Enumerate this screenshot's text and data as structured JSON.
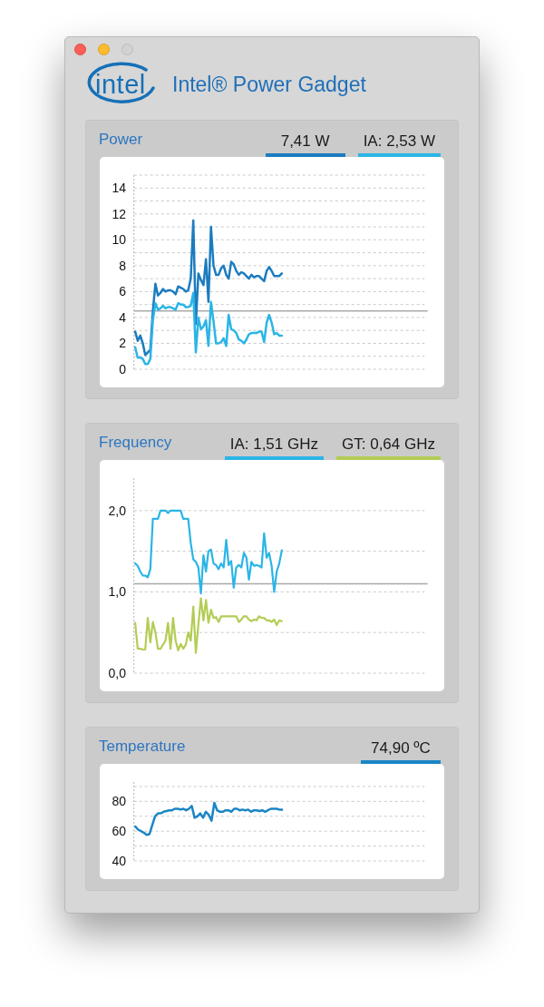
{
  "window": {
    "controls": [
      {
        "kind": "close",
        "disabled": false
      },
      {
        "kind": "minimize",
        "disabled": false
      },
      {
        "kind": "zoom",
        "disabled": true
      }
    ]
  },
  "header": {
    "logo": {
      "text": "intel"
    },
    "title": "Intel® Power Gadget"
  },
  "panels": [
    {
      "title": "Power",
      "readouts": [
        {
          "text": "7,41 W",
          "color": "#1b7cbf"
        },
        {
          "text": "IA: 2,53 W",
          "color": "#2bb5e6"
        }
      ],
      "chart_data": {
        "type": "line",
        "ylim": [
          0,
          15
        ],
        "yticks": [
          0,
          2,
          4,
          6,
          8,
          10,
          12,
          14
        ],
        "grid": true,
        "series": [
          {
            "color": "#1b7cbf",
            "values": [
              2.9,
              2.2,
              2.6,
              2.0,
              1.1,
              1.3,
              1.5,
              4.5,
              6.6,
              5.7,
              5.9,
              6.2,
              6.0,
              6.1,
              6.1,
              6.0,
              5.8,
              6.4,
              6.3,
              6.2,
              6.0,
              6.1,
              7.0,
              11.5,
              3.5,
              7.4,
              6.9,
              6.5,
              8.5,
              5.2,
              11.0,
              8.0,
              7.3,
              7.3,
              7.8,
              8.0,
              7.3,
              7.0,
              8.3,
              8.1,
              7.6,
              7.3,
              7.5,
              7.4,
              7.2,
              7.0,
              7.3,
              7.1,
              7.2,
              7.2,
              7.0,
              6.8,
              7.6,
              7.9,
              7.6,
              7.2,
              7.2,
              7.2,
              7.4,
              null,
              null,
              null,
              null,
              null,
              null,
              null,
              null,
              null,
              null,
              null,
              null,
              null,
              null,
              null,
              null,
              null,
              null,
              null,
              null,
              null,
              null,
              null,
              null,
              null,
              null,
              null,
              null,
              null,
              null,
              null,
              null,
              null,
              null,
              null,
              null,
              null,
              null,
              null,
              null,
              null,
              null,
              null,
              null,
              null,
              null,
              null,
              null,
              null,
              null,
              null,
              null,
              null,
              null,
              null,
              null
            ]
          },
          {
            "color": "#2bb5e6",
            "values": [
              1.7,
              0.9,
              0.9,
              0.8,
              0.4,
              0.4,
              0.8,
              3.8,
              5.1,
              4.6,
              4.7,
              4.9,
              4.7,
              4.8,
              4.8,
              4.7,
              4.6,
              5.1,
              5.0,
              5.0,
              4.8,
              4.8,
              4.9,
              5.9,
              1.3,
              4.0,
              3.1,
              3.3,
              3.8,
              1.8,
              5.2,
              3.7,
              2.0,
              2.0,
              2.1,
              2.4,
              1.8,
              4.2,
              3.1,
              3.0,
              2.8,
              2.3,
              2.2,
              2.0,
              2.3,
              2.7,
              2.8,
              2.8,
              2.8,
              2.9,
              2.9,
              2.1,
              3.6,
              4.2,
              3.6,
              2.7,
              2.8,
              2.6,
              2.6,
              null,
              null,
              null,
              null,
              null,
              null,
              null,
              null,
              null,
              null,
              null,
              null,
              null,
              null,
              null,
              null,
              null,
              null,
              null,
              null,
              null,
              null,
              null,
              null,
              null,
              null,
              null,
              null,
              null,
              null,
              null,
              null,
              null,
              null,
              null,
              null,
              null,
              null,
              null,
              null,
              null,
              null,
              null,
              null,
              null,
              null,
              null,
              null,
              null,
              null,
              null,
              null,
              null,
              null,
              null,
              null
            ]
          }
        ],
        "ref_lines": [
          {
            "axis": "y",
            "value": 4.5
          }
        ]
      }
    },
    {
      "title": "Frequency",
      "readouts": [
        {
          "text": "IA: 1,51 GHz",
          "color": "#2bb5e6"
        },
        {
          "text": "GT: 0,64 GHz",
          "color": "#b3cd55"
        }
      ],
      "chart_data": {
        "type": "line",
        "ylim": [
          0,
          2.4
        ],
        "yticks": [
          {
            "value": 0,
            "label": "0,0"
          },
          {
            "value": 1,
            "label": "1,0"
          },
          {
            "value": 2,
            "label": "2,0"
          }
        ],
        "grid": true,
        "series": [
          {
            "color": "#2bb5e6",
            "values": [
              1.35,
              1.32,
              1.25,
              1.2,
              1.2,
              1.18,
              1.28,
              1.9,
              1.9,
              1.9,
              2.0,
              2.0,
              2.0,
              1.97,
              2.0,
              2.0,
              2.0,
              2.0,
              2.0,
              1.9,
              1.9,
              1.9,
              1.6,
              1.4,
              1.37,
              1.3,
              0.98,
              1.45,
              1.25,
              1.5,
              1.52,
              1.35,
              1.33,
              1.28,
              1.35,
              1.3,
              1.64,
              1.33,
              1.38,
              1.05,
              1.3,
              1.33,
              1.3,
              1.48,
              1.42,
              1.15,
              1.37,
              1.32,
              1.33,
              1.32,
              1.3,
              1.72,
              1.42,
              1.48,
              1.32,
              1.0,
              1.25,
              1.35,
              1.51,
              null,
              null,
              null,
              null,
              null,
              null,
              null,
              null,
              null,
              null,
              null,
              null,
              null,
              null,
              null,
              null,
              null,
              null,
              null,
              null,
              null,
              null,
              null,
              null,
              null,
              null,
              null,
              null,
              null,
              null,
              null,
              null,
              null,
              null,
              null,
              null,
              null,
              null,
              null,
              null,
              null,
              null,
              null,
              null,
              null,
              null,
              null,
              null,
              null,
              null,
              null,
              null,
              null,
              null,
              null,
              null
            ]
          },
          {
            "color": "#b3cd55",
            "values": [
              0.62,
              0.3,
              0.3,
              0.29,
              0.29,
              0.68,
              0.38,
              0.63,
              0.5,
              0.3,
              0.3,
              0.35,
              0.4,
              0.62,
              0.3,
              0.68,
              0.4,
              0.28,
              0.36,
              0.3,
              0.35,
              0.5,
              0.4,
              0.82,
              0.25,
              0.6,
              0.92,
              0.65,
              0.9,
              0.62,
              0.78,
              0.68,
              0.69,
              0.63,
              0.7,
              0.7,
              0.7,
              0.7,
              0.7,
              0.7,
              0.7,
              0.63,
              0.66,
              0.7,
              0.7,
              0.66,
              0.64,
              0.66,
              0.65,
              0.7,
              0.68,
              0.68,
              0.65,
              0.65,
              0.63,
              0.66,
              0.59,
              0.65,
              0.64,
              null,
              null,
              null,
              null,
              null,
              null,
              null,
              null,
              null,
              null,
              null,
              null,
              null,
              null,
              null,
              null,
              null,
              null,
              null,
              null,
              null,
              null,
              null,
              null,
              null,
              null,
              null,
              null,
              null,
              null,
              null,
              null,
              null,
              null,
              null,
              null,
              null,
              null,
              null,
              null,
              null,
              null,
              null,
              null,
              null,
              null,
              null,
              null,
              null,
              null,
              null,
              null,
              null,
              null,
              null,
              null
            ]
          }
        ],
        "ref_lines": [
          {
            "axis": "y",
            "value": 1.1
          }
        ]
      }
    },
    {
      "title": "Temperature",
      "readouts": [
        {
          "text": "74,90 ºC",
          "color": "#1b85c6"
        }
      ],
      "chart_data": {
        "type": "line",
        "ylim": [
          40,
          93
        ],
        "yticks": [
          40,
          60,
          80
        ],
        "grid": true,
        "series": [
          {
            "color": "#1b85c6",
            "values": [
              63,
              61,
              60,
              59,
              57.5,
              58,
              64,
              70,
              72,
              72,
              73,
              73.5,
              74,
              74,
              75,
              75,
              74.5,
              75,
              74,
              75,
              77,
              69,
              70,
              72,
              69,
              73,
              71,
              67,
              79,
              74,
              73,
              73,
              74,
              74,
              73,
              75,
              75,
              74,
              74.5,
              74,
              74.5,
              73,
              74,
              74,
              73.5,
              74,
              73,
              74,
              75,
              75,
              75,
              74.5,
              74.5,
              null,
              null,
              null,
              null,
              null,
              null,
              null,
              null,
              null,
              null,
              null,
              null,
              null,
              null,
              null,
              null,
              null,
              null,
              null,
              null,
              null,
              null,
              null,
              null,
              null,
              null,
              null,
              null,
              null,
              null,
              null,
              null,
              null,
              null,
              null,
              null,
              null,
              null,
              null,
              null,
              null,
              null,
              null,
              null,
              null,
              null,
              null,
              null,
              null,
              null
            ]
          }
        ]
      }
    }
  ]
}
